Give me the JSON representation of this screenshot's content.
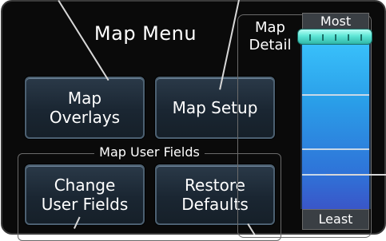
{
  "menu": {
    "title": "Map Menu",
    "buttons": {
      "map_overlays": [
        "Map",
        "Overlays"
      ],
      "map_setup": [
        "Map Setup"
      ],
      "change_user_fields": [
        "Change",
        "User Fields"
      ],
      "restore_defaults": [
        "Restore",
        "Defaults"
      ]
    },
    "group_label": "Map User Fields"
  },
  "map_detail": {
    "label": [
      "Map",
      "Detail"
    ],
    "most_label": "Most",
    "least_label": "Least",
    "level_fraction": 1.0
  },
  "colors": {
    "background": "#0a0a0a",
    "button_border": "#4c6071",
    "slider_top": "#3cc8ff",
    "slider_bottom": "#3a56c8",
    "handle": "#5ee6d6"
  }
}
